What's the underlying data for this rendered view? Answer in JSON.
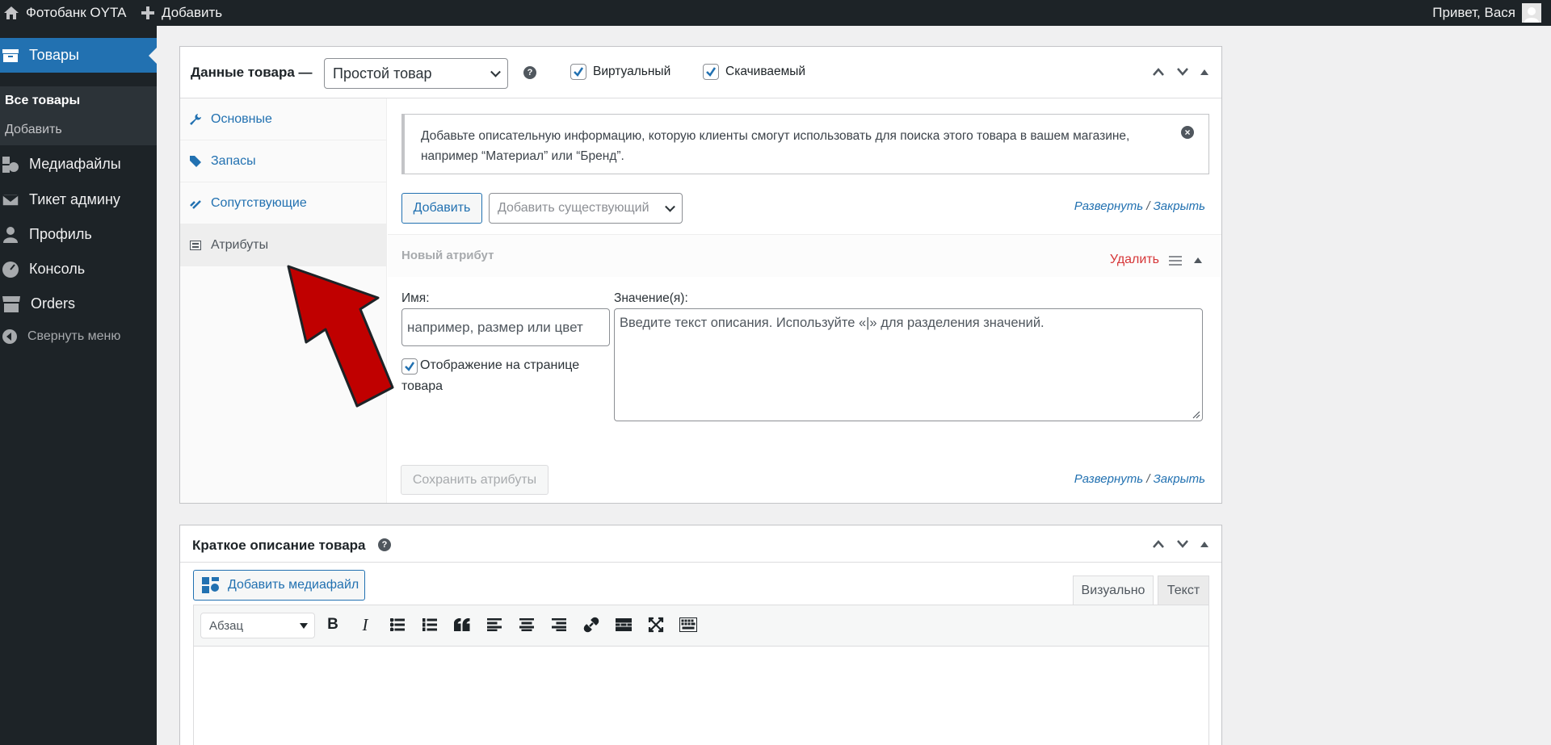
{
  "adminbar": {
    "site_name": "Фотобанк OYTA",
    "add_new": "Добавить",
    "greeting": "Привет, Вася"
  },
  "sidebar": {
    "active_menu": "Товары",
    "submenu": [
      "Все товары",
      "Добавить"
    ],
    "items": [
      "Медиафайлы",
      "Тикет админу",
      "Профиль",
      "Консоль",
      "Orders"
    ],
    "collapse": "Свернуть меню"
  },
  "product_data": {
    "title": "Данные товара —",
    "product_type": "Простой товар",
    "virtual_label": "Виртуальный",
    "downloadable_label": "Скачиваемый",
    "virtual_checked": true,
    "downloadable_checked": true,
    "tabs": [
      "Основные",
      "Запасы",
      "Сопутствующие",
      "Атрибуты"
    ],
    "active_tab": "Атрибуты",
    "notice": "Добавьте описательную информацию, которую клиенты смогут использовать для поиска этого товара в вашем магазине, например “Материал” или “Бренд”.",
    "add_button": "Добавить",
    "add_existing_placeholder": "Добавить существующий",
    "expand": "Развернуть",
    "separator": "/",
    "close": "Закрыть",
    "new_attribute": "Новый атрибут",
    "delete": "Удалить",
    "name_label": "Имя:",
    "name_placeholder": "например, размер или цвет",
    "values_label": "Значение(я):",
    "values_placeholder": "Введите текст описания. Используйте «|» для разделения значений.",
    "visible_label": "Отображение на странице товара",
    "visible_checked": true,
    "save_attributes": "Сохранить атрибуты"
  },
  "short_description": {
    "title": "Краткое описание товара",
    "add_media": "Добавить медиафайл",
    "tab_visual": "Визуально",
    "tab_text": "Текст",
    "format_select": "Абзац",
    "toolbar_icons": [
      "bold-icon",
      "italic-icon",
      "bullet-list-icon",
      "numbered-list-icon",
      "blockquote-icon",
      "align-left-icon",
      "align-center-icon",
      "align-right-icon",
      "link-icon",
      "read-more-icon",
      "fullscreen-icon",
      "toolbar-toggle-icon"
    ]
  },
  "colors": {
    "accent": "#2271b1",
    "admin_dark": "#1d2327",
    "delete_red": "#d63638",
    "annotation_arrow": "#c00000"
  }
}
